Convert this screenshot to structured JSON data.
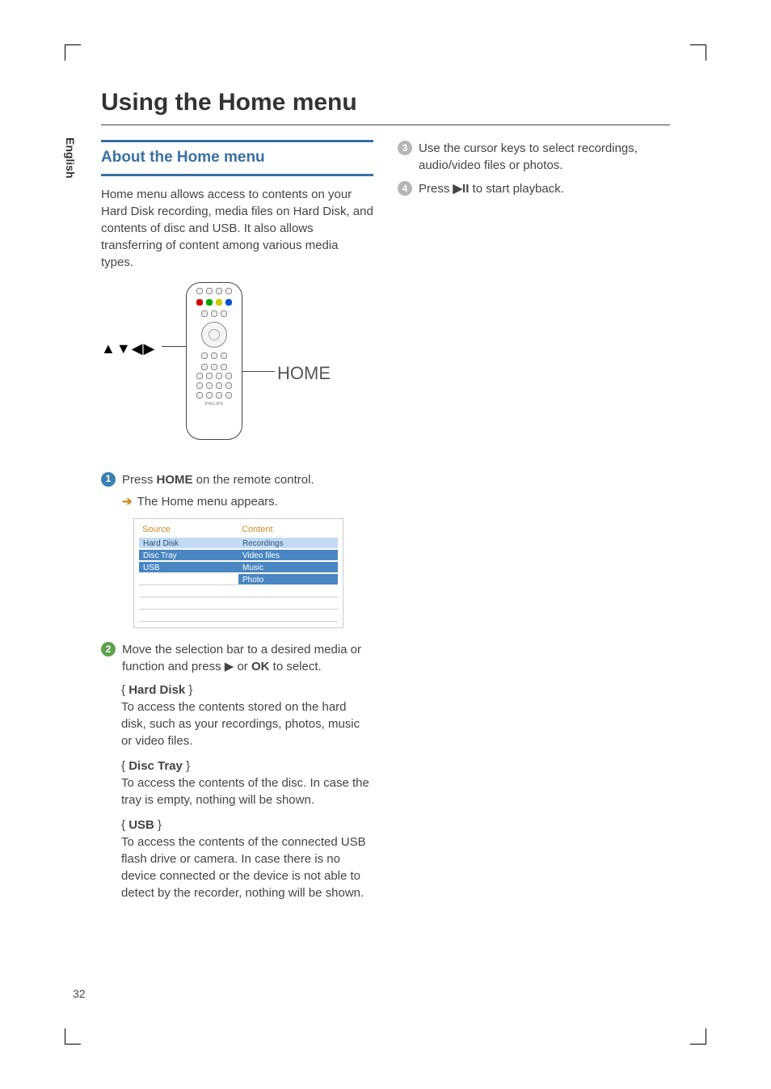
{
  "language_tab": "English",
  "page_title": "Using the Home menu",
  "section_about_title": "About the Home menu",
  "about_para": "Home menu allows access to contents on your Hard Disk recording, media files on Hard Disk, and contents of disc and USB. It also allows transferring of content among various media types.",
  "remote_figure": {
    "arrows_cluster": "▲▼◀▶",
    "home_label": "HOME",
    "brand": "PHILIPS"
  },
  "steps": {
    "s1_num": "1",
    "s1_text_a": "Press ",
    "s1_text_bold": "HOME",
    "s1_text_b": " on the remote control.",
    "s1_sub": "The Home menu appears.",
    "s2_num": "2",
    "s2_text_a": "Move the selection bar to a desired media or function and press ",
    "s2_glyph": "▶",
    "s2_text_b": " or ",
    "s2_ok": "OK",
    "s2_text_c": " to select.",
    "s3_num": "3",
    "s3_text": "Use the cursor keys to select recordings, audio/video files or photos.",
    "s4_num": "4",
    "s4_text_a": "Press ",
    "s4_glyph": "▶II",
    "s4_text_b": " to start playback."
  },
  "menu_figure": {
    "source_header": "Source",
    "content_header": "Content",
    "source_items": [
      "Hard Disk",
      "Disc Tray",
      "USB"
    ],
    "content_items": [
      "Recordings",
      "Video files",
      "Music",
      "Photo"
    ]
  },
  "options": {
    "hd_label": "Hard Disk",
    "hd_desc": "To access the contents stored on the hard disk, such as your recordings, photos, music or video files.",
    "disc_label": "Disc Tray",
    "disc_desc": "To access the contents of the disc. In case the tray is empty, nothing will be shown.",
    "usb_label": "USB",
    "usb_desc": "To access the contents of the connected USB flash drive or camera.  In case there is no device connected or the device is not able to detect by the recorder, nothing will be shown."
  },
  "page_number": "32"
}
